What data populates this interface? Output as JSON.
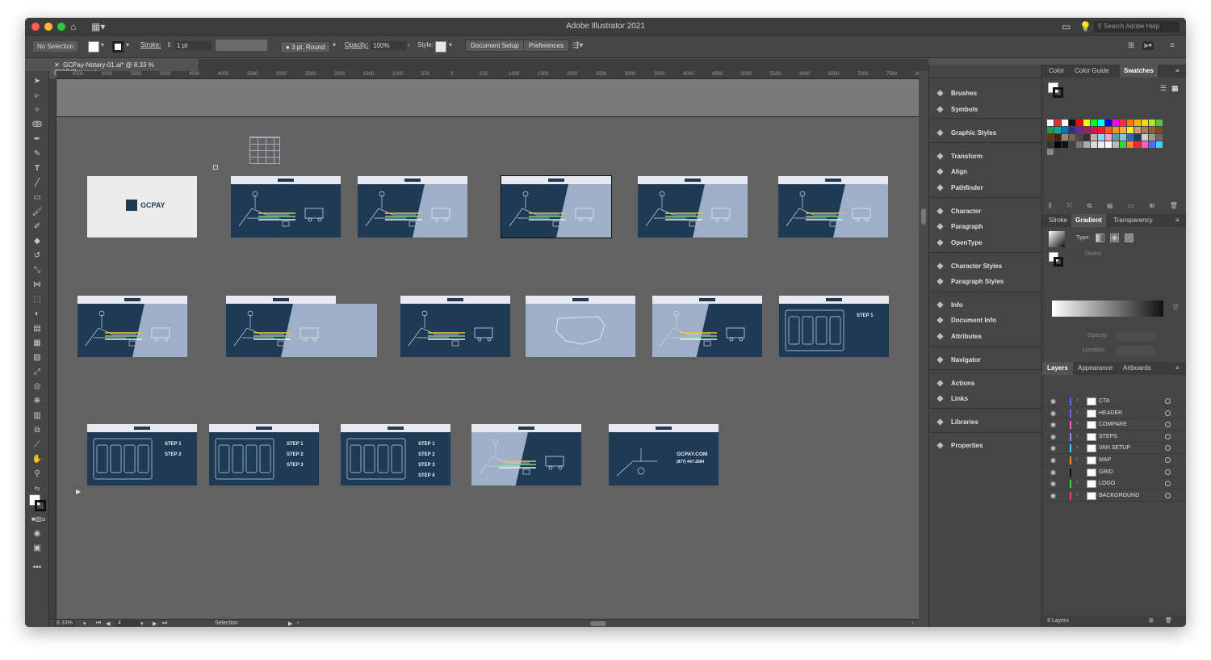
{
  "app": {
    "title": "Adobe Illustrator 2021",
    "search_placeholder": "Search Adobe Help"
  },
  "control_bar": {
    "selection": "No Selection",
    "stroke_label": "Stroke:",
    "stroke_value": "1 pt",
    "brush": "3 pt. Round",
    "opacity_label": "Opacity:",
    "opacity_value": "100%",
    "style_label": "Style:",
    "document_setup": "Document Setup",
    "preferences": "Preferences"
  },
  "document_tab": "GCPay-Notary-01.ai* @ 8.33 % (RGB/Preview)",
  "ruler_labels": [
    "6500",
    "6000",
    "5500",
    "5000",
    "4500",
    "4000",
    "3500",
    "3000",
    "2500",
    "2000",
    "1500",
    "1000",
    "500",
    "0",
    "500",
    "1000",
    "1500",
    "2000",
    "2500",
    "3000",
    "3500",
    "4000",
    "4500",
    "5000",
    "5500",
    "6000",
    "6500",
    "7000",
    "7500",
    "8000"
  ],
  "artboards": {
    "logo_text": "GCPAY",
    "step_labels": [
      "STEP 1",
      "STEP 2",
      "STEP 3",
      "STEP 4"
    ],
    "cta_url": "GCPAY.COM",
    "cta_phone": "(877) 447-2584"
  },
  "status": {
    "zoom": "8.33%",
    "artboard_index": "4",
    "tool": "Selection"
  },
  "panels_mid": [
    {
      "label": "Brushes",
      "icon": "brush-icon"
    },
    {
      "label": "Symbols",
      "icon": "symbols-icon"
    },
    {
      "label": "Graphic Styles",
      "icon": "graphic-styles-icon"
    },
    {
      "label": "Transform",
      "icon": "transform-icon"
    },
    {
      "label": "Align",
      "icon": "align-icon"
    },
    {
      "label": "Pathfinder",
      "icon": "pathfinder-icon"
    },
    {
      "label": "Character",
      "icon": "character-icon"
    },
    {
      "label": "Paragraph",
      "icon": "paragraph-icon"
    },
    {
      "label": "OpenType",
      "icon": "opentype-icon"
    },
    {
      "label": "Character Styles",
      "icon": "character-styles-icon"
    },
    {
      "label": "Paragraph Styles",
      "icon": "paragraph-styles-icon"
    },
    {
      "label": "Info",
      "icon": "info-icon"
    },
    {
      "label": "Document Info",
      "icon": "document-info-icon"
    },
    {
      "label": "Attributes",
      "icon": "attributes-icon"
    },
    {
      "label": "Navigator",
      "icon": "navigator-icon"
    },
    {
      "label": "Actions",
      "icon": "actions-icon"
    },
    {
      "label": "Links",
      "icon": "links-icon"
    },
    {
      "label": "Libraries",
      "icon": "libraries-icon"
    },
    {
      "label": "Properties",
      "icon": "properties-icon"
    }
  ],
  "color_tabs": [
    "Color",
    "Color Guide",
    "Swatches"
  ],
  "gradient_tabs": [
    "Stroke",
    "Gradient",
    "Transparency"
  ],
  "gradient": {
    "type_label": "Type:",
    "stroke_label": "Stroke:",
    "opacity_label": "Opacity:",
    "location_label": "Location:"
  },
  "layers_tabs": [
    "Layers",
    "Appearance",
    "Artboards"
  ],
  "layers": [
    {
      "name": "CTA",
      "color": "#4f6dff"
    },
    {
      "name": "HEADER",
      "color": "#7b5cff"
    },
    {
      "name": "COMPARE",
      "color": "#ff5ccf"
    },
    {
      "name": "STEPS",
      "color": "#8c8cff"
    },
    {
      "name": "VAN SETUP",
      "color": "#37d2ff"
    },
    {
      "name": "MAP",
      "color": "#ff8a2b"
    },
    {
      "name": "GRID",
      "color": "#111111"
    },
    {
      "name": "LOGO",
      "color": "#3bd13b"
    },
    {
      "name": "BACKGROUND",
      "color": "#ff4040"
    }
  ],
  "layers_count": "9 Layers"
}
